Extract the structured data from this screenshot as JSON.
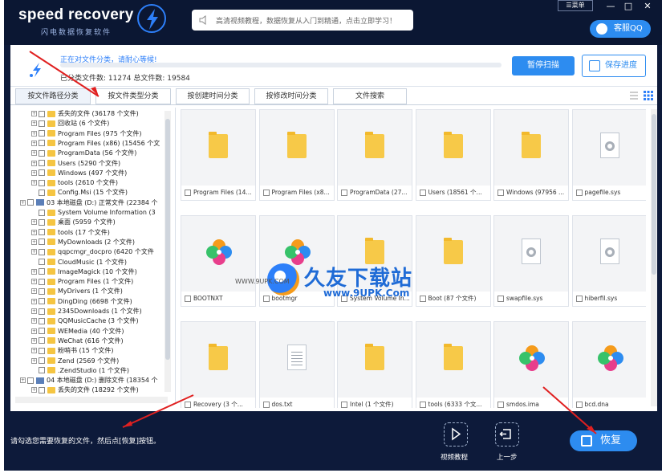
{
  "app": {
    "logo_text": "speed recovery",
    "logo_sub": "闪电数据恢复软件",
    "notice": "高清视频教程，数据恢复从入门到精通，点击立即学习！",
    "menu_label": "菜单",
    "min_label": "—",
    "restore_label": "□",
    "close_label": "✕",
    "qq_label": "客服QQ"
  },
  "progress": {
    "status_text": "正在对文件分类，请耐心等候!",
    "counts_text": "已分类文件数: 11274  总文件数: 19584",
    "progress_fraction": 0.0,
    "pause_button": "暂停扫描",
    "save_button": "保存进度"
  },
  "tabs": [
    "按文件路径分类",
    "按文件类型分类",
    "按创建时间分类",
    "按修改时间分类",
    "文件搜索"
  ],
  "tree": [
    {
      "label": "丢失的文件   (36178 个文件)",
      "indent": 1,
      "exp": true,
      "icon": "folder"
    },
    {
      "label": "回收站   (6 个文件)",
      "indent": 1,
      "exp": true,
      "icon": "folder"
    },
    {
      "label": "Program Files   (975 个文件)",
      "indent": 1,
      "exp": true,
      "icon": "folder"
    },
    {
      "label": "Program Files (x86)   (15456 个文",
      "indent": 1,
      "exp": true,
      "icon": "folder"
    },
    {
      "label": "ProgramData   (56 个文件)",
      "indent": 1,
      "exp": true,
      "icon": "folder"
    },
    {
      "label": "Users   (5290 个文件)",
      "indent": 1,
      "exp": true,
      "icon": "folder"
    },
    {
      "label": "Windows   (497 个文件)",
      "indent": 1,
      "exp": true,
      "icon": "folder"
    },
    {
      "label": "tools   (2610 个文件)",
      "indent": 1,
      "exp": true,
      "icon": "folder"
    },
    {
      "label": "Config.Msi   (15 个文件)",
      "indent": 1,
      "exp": false,
      "icon": "folder"
    },
    {
      "label": "03 本地磁盘 (D:) 正常文件 (22384 个",
      "indent": 0,
      "exp": true,
      "icon": "disk"
    },
    {
      "label": "System Volume Information   (3",
      "indent": 1,
      "exp": false,
      "icon": "folder"
    },
    {
      "label": "桌面   (5959 个文件)",
      "indent": 1,
      "exp": true,
      "icon": "folder"
    },
    {
      "label": "tools   (17 个文件)",
      "indent": 1,
      "exp": true,
      "icon": "folder"
    },
    {
      "label": "MyDownloads   (2 个文件)",
      "indent": 1,
      "exp": true,
      "icon": "folder"
    },
    {
      "label": "qqpcmgr_docpro   (6420 个文件",
      "indent": 1,
      "exp": true,
      "icon": "folder"
    },
    {
      "label": "CloudMusic   (1 个文件)",
      "indent": 1,
      "exp": false,
      "icon": "folder"
    },
    {
      "label": "ImageMagick   (10 个文件)",
      "indent": 1,
      "exp": true,
      "icon": "folder"
    },
    {
      "label": "Program Files   (1 个文件)",
      "indent": 1,
      "exp": true,
      "icon": "folder"
    },
    {
      "label": "MyDrivers   (1 个文件)",
      "indent": 1,
      "exp": true,
      "icon": "folder"
    },
    {
      "label": "DingDing   (6698 个文件)",
      "indent": 1,
      "exp": true,
      "icon": "folder"
    },
    {
      "label": "2345Downloads   (1 个文件)",
      "indent": 1,
      "exp": true,
      "icon": "folder"
    },
    {
      "label": "QQMusicCache   (3 个文件)",
      "indent": 1,
      "exp": true,
      "icon": "folder"
    },
    {
      "label": "WEMedia   (40 个文件)",
      "indent": 1,
      "exp": true,
      "icon": "folder"
    },
    {
      "label": "WeChat   (616 个文件)",
      "indent": 1,
      "exp": true,
      "icon": "folder"
    },
    {
      "label": "粉哨书   (15 个文件)",
      "indent": 1,
      "exp": true,
      "icon": "folder"
    },
    {
      "label": "Zend   (2569 个文件)",
      "indent": 1,
      "exp": true,
      "icon": "folder"
    },
    {
      "label": ".ZendStudio   (1 个文件)",
      "indent": 1,
      "exp": false,
      "icon": "folder"
    },
    {
      "label": "04 本地磁盘 (D:) 删除文件 (18354 个",
      "indent": 0,
      "exp": true,
      "icon": "disk"
    },
    {
      "label": "丢失的文件   (18292 个文件)",
      "indent": 1,
      "exp": true,
      "icon": "folder"
    }
  ],
  "cards": [
    {
      "label": "Program Files (14...",
      "kind": "folder"
    },
    {
      "label": "Program Files (x8...",
      "kind": "folder"
    },
    {
      "label": "ProgramData (27...",
      "kind": "folder"
    },
    {
      "label": "Users (18561 个...",
      "kind": "folder"
    },
    {
      "label": "Windows (97956 ...",
      "kind": "folder"
    },
    {
      "label": "pagefile.sys",
      "kind": "sys"
    },
    {
      "label": "BOOTNXT",
      "kind": "flower"
    },
    {
      "label": "bootmgr",
      "kind": "flower"
    },
    {
      "label": "System Volume In...",
      "kind": "folder"
    },
    {
      "label": "Boot (87 个文件)",
      "kind": "folder"
    },
    {
      "label": "swapfile.sys",
      "kind": "sys"
    },
    {
      "label": "hiberfil.sys",
      "kind": "sys"
    },
    {
      "label": "Recovery (3 个...",
      "kind": "folder"
    },
    {
      "label": "dos.txt",
      "kind": "txt"
    },
    {
      "label": "Intel (1 个文件)",
      "kind": "folder"
    },
    {
      "label": "tools (6333 个文...",
      "kind": "folder"
    },
    {
      "label": "smdos.ima",
      "kind": "flower"
    },
    {
      "label": "bcd.dna",
      "kind": "flower"
    }
  ],
  "footer": {
    "hint": "请勾选您需要恢复的文件，然后点[恢复]按钮。",
    "video_label": "视频教程",
    "back_label": "上一步",
    "recover_label": "恢复"
  },
  "watermark": {
    "cn": "久友下载站",
    "url": "www.9UPK.Com",
    "www": "WWW.9UPK.COM"
  },
  "colors": {
    "header_bg": "#0b1733",
    "accent": "#2d8cf0",
    "folder": "#f7c948"
  }
}
